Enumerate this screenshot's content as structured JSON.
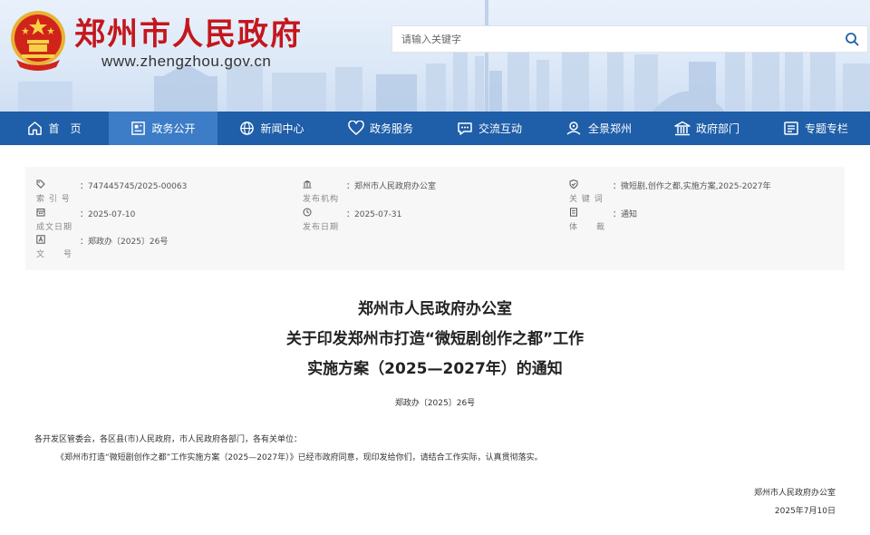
{
  "header": {
    "site_title": "郑州市人民政府",
    "site_url": "www.zhengzhou.gov.cn",
    "search_placeholder": "请输入关键字"
  },
  "nav": [
    {
      "label": "首　页",
      "icon": "home-icon",
      "active": false
    },
    {
      "label": "政务公开",
      "icon": "notice-board-icon",
      "active": true
    },
    {
      "label": "新闻中心",
      "icon": "globe-icon",
      "active": false
    },
    {
      "label": "政务服务",
      "icon": "heart-icon",
      "active": false
    },
    {
      "label": "交流互动",
      "icon": "chat-icon",
      "active": false
    },
    {
      "label": "全景郑州",
      "icon": "panorama-icon",
      "active": false
    },
    {
      "label": "政府部门",
      "icon": "government-building-icon",
      "active": false
    },
    {
      "label": "专题专栏",
      "icon": "column-list-icon",
      "active": false
    }
  ],
  "meta": {
    "index_label": "索 引 号",
    "index_value": "：747445745/2025-00063",
    "publisher_label": "发布机构",
    "publisher_value": "：郑州市人民政府办公室",
    "keywords_label": "关 键 词",
    "keywords_value": "：微短剧,创作之都,实施方案,2025-2027年",
    "created_label": "成文日期",
    "created_value": "：2025-07-10",
    "published_label": "发布日期",
    "published_value": "：2025-07-31",
    "genre_label": "体　　裁",
    "genre_value": "：通知",
    "docno_label": "文　　号",
    "docno_value": "：郑政办〔2025〕26号"
  },
  "document": {
    "title_line1": "郑州市人民政府办公室",
    "title_line2": "关于印发郑州市打造“微短剧创作之都”工作",
    "title_line3": "实施方案（2025—2027年）的通知",
    "doc_number": "郑政办〔2025〕26号",
    "salutation": "各开发区管委会，各区县(市)人民政府，市人民政府各部门，各有关单位：",
    "body": "《郑州市打造“微短剧创作之都”工作实施方案（2025—2027年）》已经市政府同意，现印发给你们，请结合工作实际，认真贯彻落实。",
    "signature": "郑州市人民政府办公室",
    "date": "2025年7月10日"
  },
  "colors": {
    "brand_red": "#c4161c",
    "nav_blue": "#1f5ea8",
    "nav_active": "#3d7cc6"
  }
}
